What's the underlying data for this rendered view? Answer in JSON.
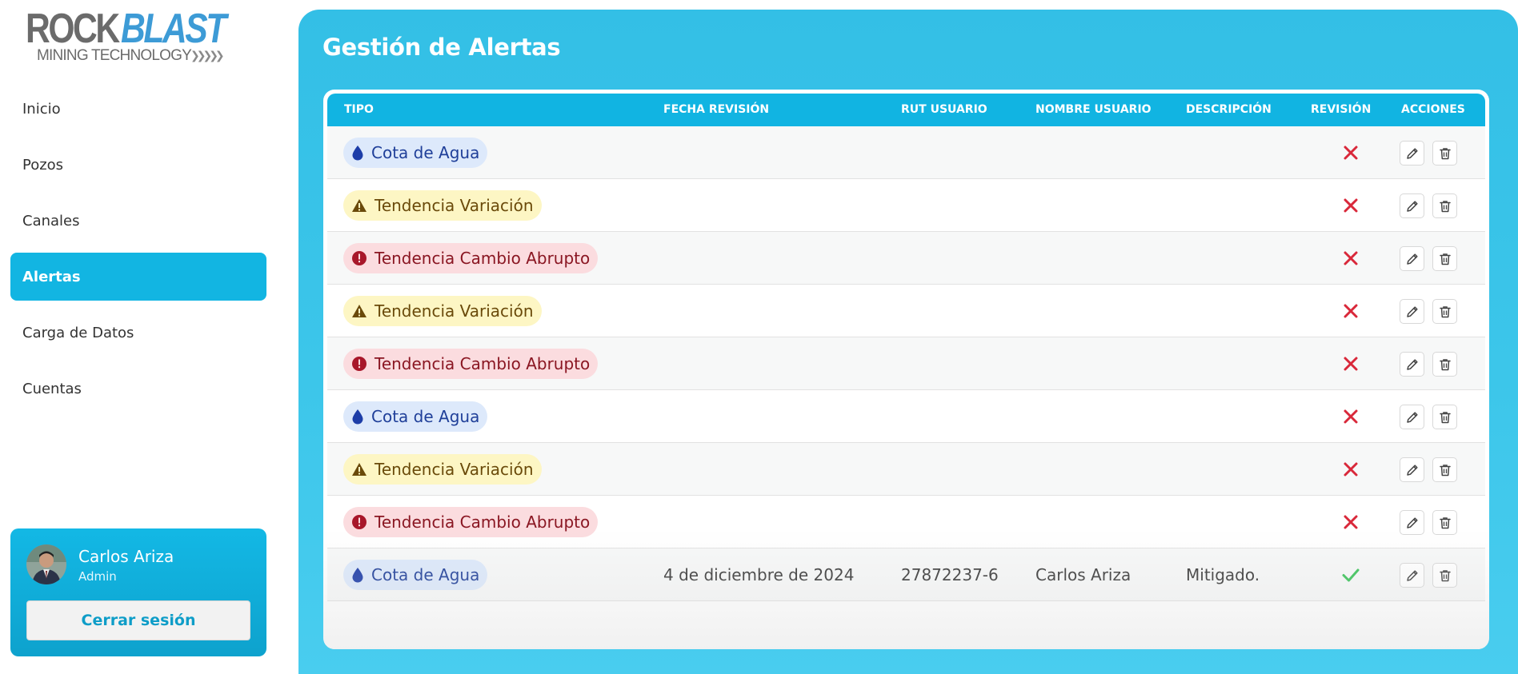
{
  "logo": {
    "rock": "ROCK",
    "blast": "BLAST",
    "subtitle": "MINING TECHNOLOGY",
    "arrows": "❯❯❯❯❯"
  },
  "nav": {
    "items": [
      {
        "label": "Inicio",
        "active": false
      },
      {
        "label": "Pozos",
        "active": false
      },
      {
        "label": "Canales",
        "active": false
      },
      {
        "label": "Alertas",
        "active": true
      },
      {
        "label": "Carga de Datos",
        "active": false
      },
      {
        "label": "Cuentas",
        "active": false
      }
    ]
  },
  "user": {
    "name": "Carlos Ariza",
    "role": "Admin",
    "logout_label": "Cerrar sesión"
  },
  "page": {
    "title": "Gestión de Alertas"
  },
  "table": {
    "columns": {
      "tipo": "TIPO",
      "fecha": "FECHA REVISIÓN",
      "rut": "RUT USUARIO",
      "nombre": "NOMBRE USUARIO",
      "descripcion": "DESCRIPCIÓN",
      "revision": "REVISIÓN",
      "acciones": "ACCIONES"
    },
    "rows": [
      {
        "tipo": "Cota de Agua",
        "kind": "water",
        "fecha": "",
        "rut": "",
        "nombre": "",
        "descripcion": "",
        "revisado": false
      },
      {
        "tipo": "Tendencia Variación",
        "kind": "warn",
        "fecha": "",
        "rut": "",
        "nombre": "",
        "descripcion": "",
        "revisado": false
      },
      {
        "tipo": "Tendencia Cambio Abrupto",
        "kind": "danger",
        "fecha": "",
        "rut": "",
        "nombre": "",
        "descripcion": "",
        "revisado": false
      },
      {
        "tipo": "Tendencia Variación",
        "kind": "warn",
        "fecha": "",
        "rut": "",
        "nombre": "",
        "descripcion": "",
        "revisado": false
      },
      {
        "tipo": "Tendencia Cambio Abrupto",
        "kind": "danger",
        "fecha": "",
        "rut": "",
        "nombre": "",
        "descripcion": "",
        "revisado": false
      },
      {
        "tipo": "Cota de Agua",
        "kind": "water",
        "fecha": "",
        "rut": "",
        "nombre": "",
        "descripcion": "",
        "revisado": false
      },
      {
        "tipo": "Tendencia Variación",
        "kind": "warn",
        "fecha": "",
        "rut": "",
        "nombre": "",
        "descripcion": "",
        "revisado": false
      },
      {
        "tipo": "Tendencia Cambio Abrupto",
        "kind": "danger",
        "fecha": "",
        "rut": "",
        "nombre": "",
        "descripcion": "",
        "revisado": false
      },
      {
        "tipo": "Cota de Agua",
        "kind": "water",
        "fecha": "4 de diciembre de 2024",
        "rut": "27872237-6",
        "nombre": "Carlos Ariza",
        "descripcion": "Mitigado.",
        "revisado": true
      }
    ]
  },
  "icons": {
    "water": "water-drop-icon",
    "warn": "warning-triangle-icon",
    "danger": "exclamation-circle-icon",
    "not_reviewed": "x-icon",
    "reviewed": "check-icon",
    "edit": "pencil-icon",
    "delete": "trash-icon"
  },
  "colors": {
    "accent": "#12b5e2",
    "x_red": "#d9283a",
    "check_green": "#3cc35a"
  }
}
